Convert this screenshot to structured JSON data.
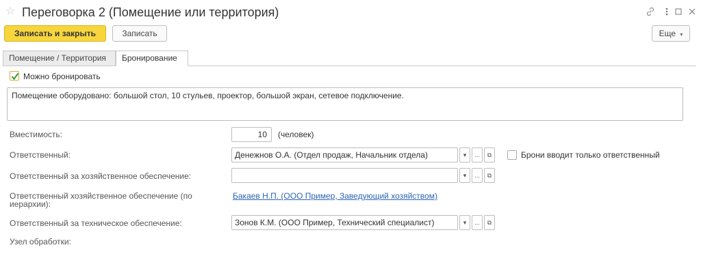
{
  "window": {
    "title": "Переговорка 2 (Помещение или территория)"
  },
  "toolbar": {
    "save_close_label": "Записать и закрыть",
    "save_label": "Записать",
    "more_label": "Еще"
  },
  "tabs": [
    {
      "label": "Помещение / Территория",
      "active": false
    },
    {
      "label": "Бронирование",
      "active": true
    }
  ],
  "booking": {
    "can_book_label": "Можно бронировать",
    "can_book_checked": true,
    "description": "Помещение оборудовано: большой стол, 10 стульев, проектор, большой экран, сетевое подключение.",
    "capacity_label": "Вместимость:",
    "capacity_value": "10",
    "capacity_unit": "(человек)",
    "responsible_label": "Ответственный:",
    "responsible_value": "Денежнов О.А. (Отдел продаж, Начальник отдела)",
    "only_responsible_label": "Брони вводит только ответственный",
    "only_responsible_checked": false,
    "household_label": "Ответственный за хозяйственное обеспечение:",
    "household_value": "",
    "household_hier_label_line1": "Ответственный хозяйственное обеспечение (по",
    "household_hier_label_line2": "иерархии):",
    "household_hier_value": "Бакаев Н.П. (ООО Пример, Заведующий хозяйством)",
    "technical_label": "Ответственный за техническое обеспечение:",
    "technical_value": "Зонов К.М. (ООО Пример, Технический специалист)",
    "node_label": "Узел обработки:"
  },
  "field_buttons": {
    "dropdown": "▾",
    "select": "...",
    "open": "⧉"
  },
  "colors": {
    "primary_button": "#f7d53d",
    "link": "#2a64b3",
    "check": "#2e9e3a"
  }
}
